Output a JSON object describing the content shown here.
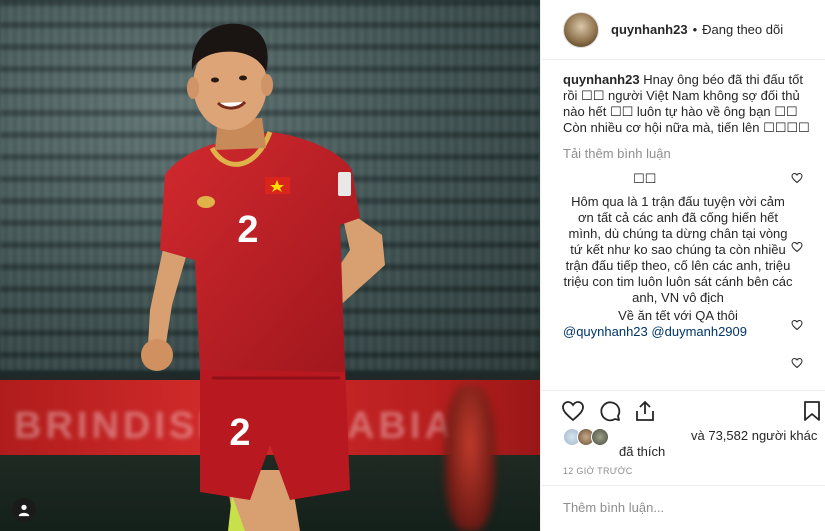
{
  "post": {
    "username": "quynhanh23",
    "follow_status": "Đang theo dõi",
    "separator": "•"
  },
  "caption": {
    "username": "quynhanh23",
    "text": "Hnay ông béo đã thi đấu tốt rồi ☐☐ người Việt Nam không sợ đối thủ nào hết ☐☐ luôn tự hào về ông bạn ☐☐ Còn nhiều cơ hội nữa mà, tiến lên ☐☐☐☐"
  },
  "load_more": "Tải thêm bình luận",
  "comments": [
    {
      "text": "☐☐"
    },
    {
      "text": "Hôm qua là 1 trận đấu tuyện vời cảm ơn tất cả các anh đã cống hiến hết mình, dù chúng ta dừng chân tại vòng tứ kết như ko sao chúng ta còn nhiều trận đấu tiếp theo, cố lên các anh, triệu triệu con tim luôn luôn sát cánh bên các anh, VN vô địch"
    },
    {
      "text": "Về ăn tết với QA thôi"
    },
    {
      "mention1": "@quynhanh23",
      "mention2": "@duymanh2909"
    }
  ],
  "likes": {
    "liked_label": "đã thích",
    "others_text": "và 73,582 người khác"
  },
  "timestamp": "12 GIỜ TRƯỚC",
  "add_comment": {
    "placeholder": "Thêm bình luận..."
  },
  "photo": {
    "board_text": "BRINDISI ... ARABIA",
    "jersey_number": "2",
    "colors": {
      "jersey": "#c41e24",
      "collar": "#e0b34a",
      "board": "#c52525"
    }
  },
  "icons": {
    "like": "heart-icon",
    "comment": "comment-icon",
    "share": "share-icon",
    "save": "bookmark-icon",
    "user": "user-icon"
  }
}
